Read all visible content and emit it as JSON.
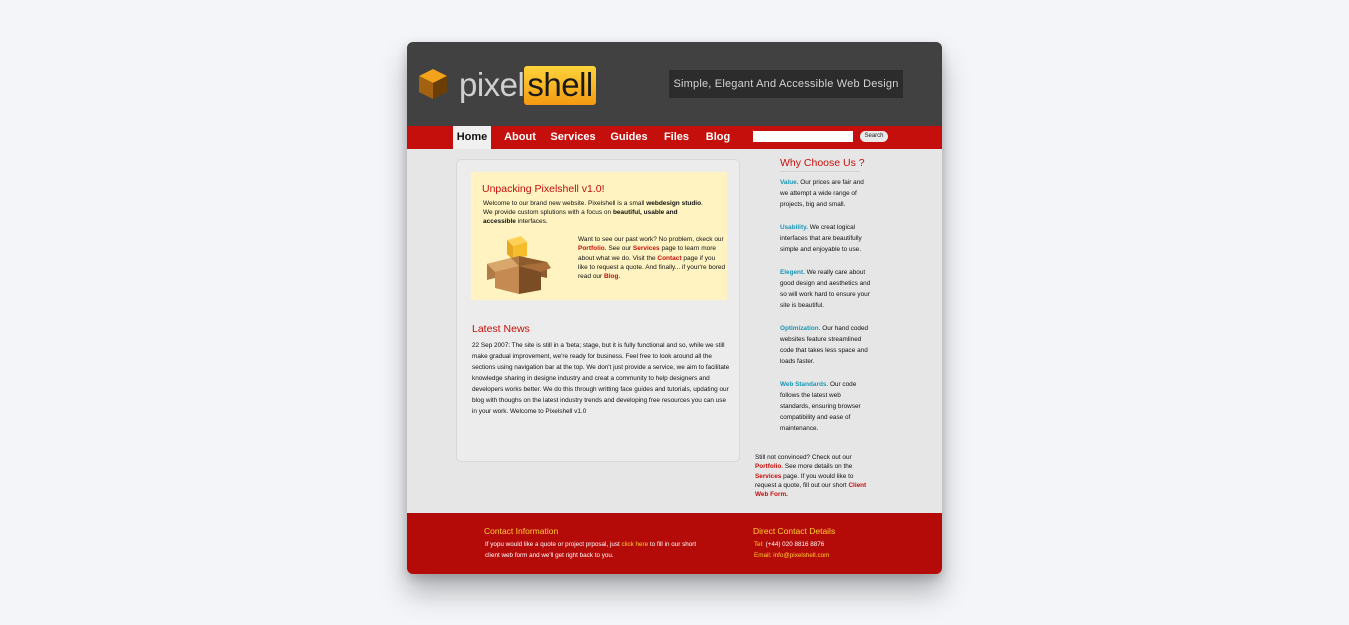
{
  "header": {
    "logo_text_1": "pixel",
    "logo_text_2": "shell",
    "tagline": "Simple, Elegant And Accessible Web Design"
  },
  "nav": {
    "items": [
      "Home",
      "About",
      "Services",
      "Guides",
      "Files",
      "Blog"
    ],
    "active": "Home",
    "search_placeholder": "",
    "search_button": "Search"
  },
  "intro": {
    "title": "Unpacking Pixelshell v1.0!",
    "p1_a": "Welcome to our brand new website. Pixelshell is a small ",
    "p1_b": "webdesign studio",
    "p1_c": ". We provide custom splutions with a focus on ",
    "p1_d": "beautiful, usable and accessible",
    "p1_e": " interfaces.",
    "p2_a": "Want to see our past work? No problem, ckeck our ",
    "p2_portfolio": "Portfolio",
    "p2_b": ". See our ",
    "p2_services": "Services",
    "p2_c": " page to learn more about what we do. Visit the ",
    "p2_contact": "Contact",
    "p2_d": " page if you like to request a quote. And finally... if your're bored read our ",
    "p2_blog": "Blog",
    "p2_e": "."
  },
  "news": {
    "title": "Latest News",
    "text": "22 Sep 2007: The site is still in a 'beta; stage, but it is fully functional and so, while we still make gradual improvement, we're ready for business. Feel free to look around all the sections using navigation bar at the top. We don't just provide a service, we aim to facilitate knowledge sharing in designe industry and creat a community to help designers and developers works better. We do this through writting face guides and tutorials, updating our blog with thoughs on the latest industry trends and developing free resources you can use in your work. Welcome to Pixelshell v1.0"
  },
  "sidebar": {
    "title": "Why Choose Us ?",
    "items": [
      {
        "key": "Value.",
        "text": " Our prices are fair and we attempt a wide range of projects, big and small."
      },
      {
        "key": "Usability.",
        "text": " We creat logical interfaces that are beautifully simple and enjoyable to use."
      },
      {
        "key": "Elegent.",
        "text": " We really care about good design and aesthetics and so will work hard to ensure your site is beautiful."
      },
      {
        "key": "Optimization.",
        "text": " Our hand coded websites feature streamlined code that takes less space and loads faster."
      },
      {
        "key": "Web Standards.",
        "text": " Our code follows the latest web standards, ensuring browser compatibility and ease of maintenance."
      }
    ],
    "footer_a": "Still not convinced? Check out our ",
    "footer_portfolio": "Portfolio",
    "footer_b": ". See more details on the ",
    "footer_services": "Services",
    "footer_c": " page. If you would like to request a quote, fill out our short ",
    "footer_form": "Client Web Form",
    "footer_d": "."
  },
  "footer": {
    "contact_title": "Contact Information",
    "contact_text_a": "If yopu would like a quote or project prposal, just ",
    "contact_link": "click here",
    "contact_text_b": " to fill in our short client web form and we'll get right back to you.",
    "direct_title": "Direct Contact Details",
    "tel_label": "Tel:",
    "tel": "(+44) 020 8816 8876",
    "email_label": "Email:",
    "email": "info@pixelshell.com"
  },
  "colors": {
    "accent_red": "#c50f0c",
    "header_dark": "#414141",
    "link_blue": "#1a97b4",
    "footer_yellow": "#ffcf2d"
  }
}
